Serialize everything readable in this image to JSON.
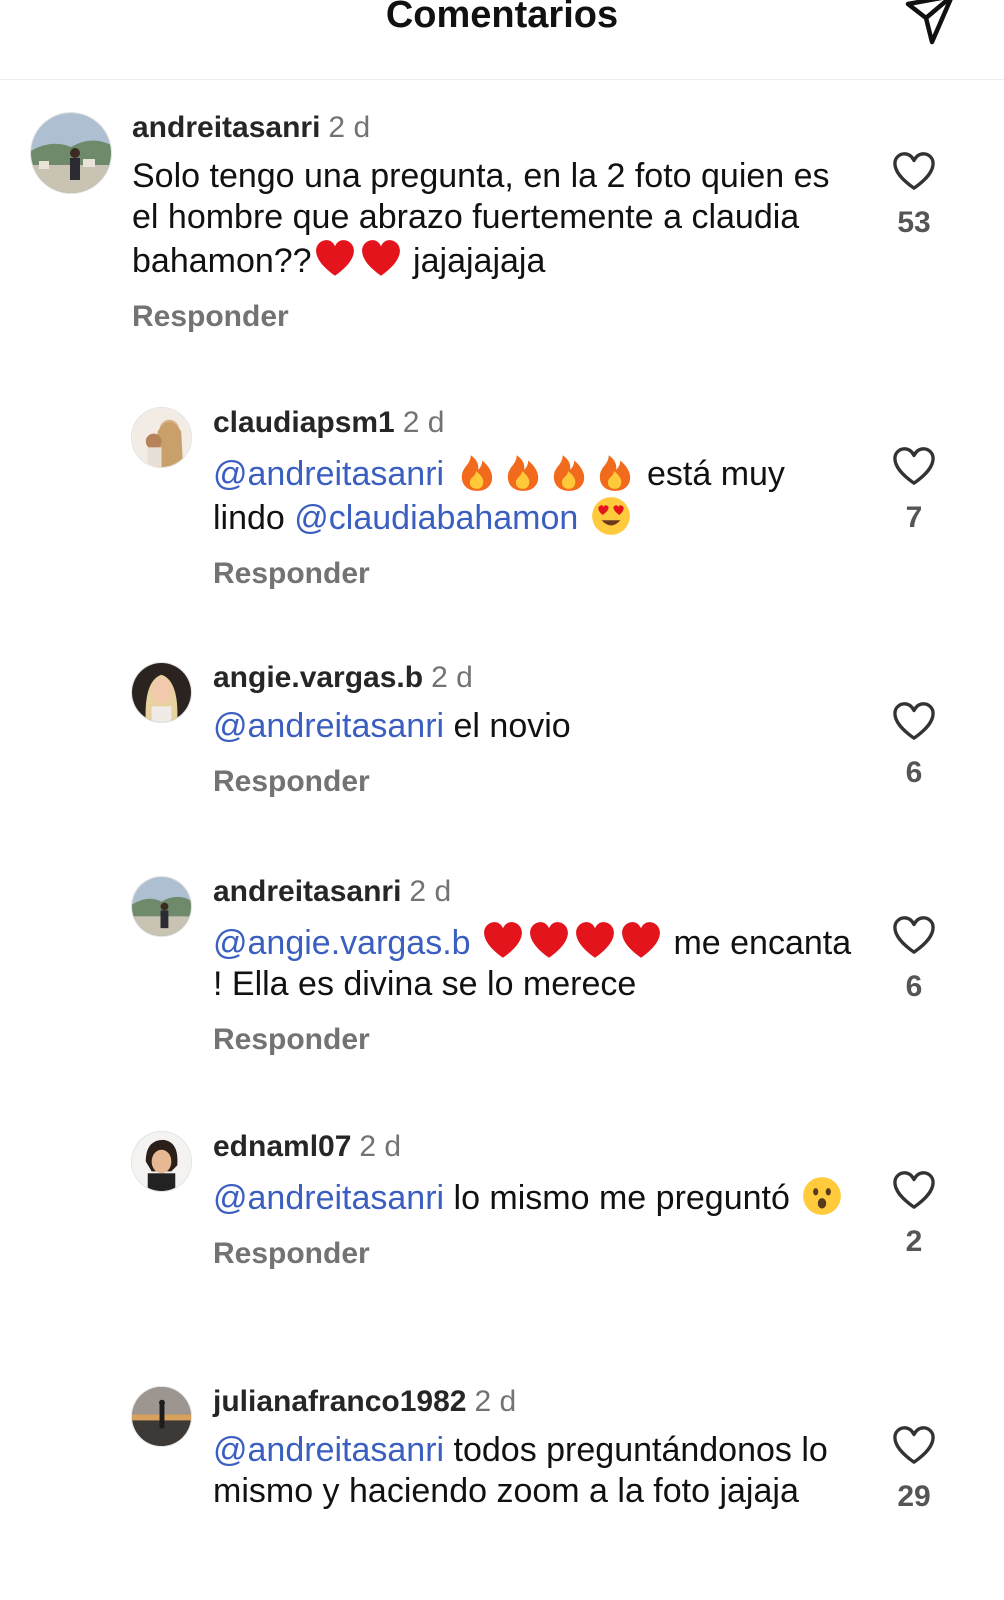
{
  "header": {
    "title": "Comentarios",
    "send_icon": "paper-plane-icon"
  },
  "reply_label": "Responder",
  "colors": {
    "mention": "#3b5fc0",
    "muted": "#737373"
  },
  "comments": [
    {
      "username": "andreitasanri",
      "time": "2 d",
      "text_1": "Solo tengo una pregunta, en la 2 foto quien es el hombre que abrazo fuertemente a claudia bahamon??",
      "text_2": " jajajajaja",
      "emojis": [
        "red-heart",
        "red-heart"
      ],
      "likes": "53"
    },
    {
      "username": "claudiapsm1",
      "time": "2 d",
      "mention_1": "@andreitasanri",
      "text_1": " está muy lindo ",
      "mention_2": "@claudiabahamon",
      "emojis": [
        "fire",
        "fire",
        "fire",
        "fire",
        "heart-eyes"
      ],
      "likes": "7"
    },
    {
      "username": "angie.vargas.b",
      "time": "2 d",
      "mention_1": "@andreitasanri",
      "text_1": " el novio",
      "likes": "6"
    },
    {
      "username": "andreitasanri",
      "time": "2 d",
      "mention_1": "@angie.vargas.b",
      "text_1": " me encanta ! Ella es divina se lo merece",
      "emojis": [
        "red-heart",
        "red-heart",
        "red-heart",
        "red-heart"
      ],
      "likes": "6"
    },
    {
      "username": "ednaml07",
      "time": "2 d",
      "mention_1": "@andreitasanri",
      "text_1": " lo mismo me preguntó",
      "emojis": [
        "surprised-face"
      ],
      "likes": "2"
    },
    {
      "username": "julianafranco1982",
      "time": "2 d",
      "mention_1": "@andreitasanri",
      "text_1": " todos preguntándonos lo mismo y haciendo zoom a la foto jajaja",
      "likes": "29"
    }
  ]
}
